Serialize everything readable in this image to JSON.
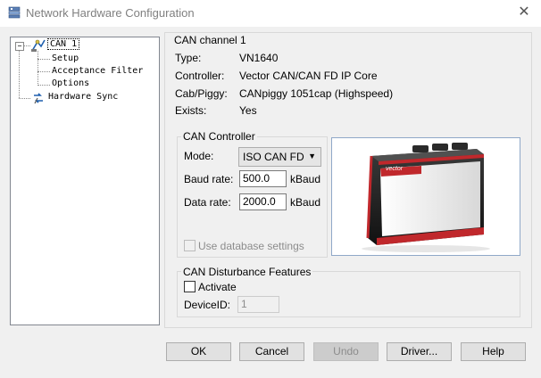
{
  "window": {
    "title": "Network Hardware Configuration",
    "close_glyph": "✕"
  },
  "tree": {
    "root_expander": "−",
    "items": [
      {
        "label": "CAN 1",
        "icon": "can-channel-icon"
      },
      {
        "label": "Setup"
      },
      {
        "label": "Acceptance Filter"
      },
      {
        "label": "Options"
      },
      {
        "label": "Hardware Sync",
        "icon": "sync-icon"
      }
    ]
  },
  "channel": {
    "group_title": "CAN channel 1",
    "type_label": "Type:",
    "type_value": "VN1640",
    "controller_label": "Controller:",
    "controller_value": "Vector CAN/CAN FD IP Core",
    "cab_label": "Cab/Piggy:",
    "cab_value": "CANpiggy 1051cap (Highspeed)",
    "exists_label": "Exists:",
    "exists_value": "Yes"
  },
  "can_controller": {
    "title": "CAN Controller",
    "mode_label": "Mode:",
    "mode_value": "ISO CAN FD",
    "baud_label": "Baud rate:",
    "baud_value": "500.0",
    "baud_unit": "kBaud",
    "data_label": "Data rate:",
    "data_value": "2000.0",
    "data_unit": "kBaud",
    "use_db_label": "Use database settings",
    "use_db_checked": false
  },
  "disturbance": {
    "title": "CAN Disturbance Features",
    "activate_label": "Activate",
    "activate_checked": false,
    "device_label": "DeviceID:",
    "device_value": "1"
  },
  "device_image": {
    "brand_text": "vector"
  },
  "buttons": {
    "ok": "OK",
    "cancel": "Cancel",
    "undo": "Undo",
    "driver": "Driver...",
    "help": "Help"
  }
}
